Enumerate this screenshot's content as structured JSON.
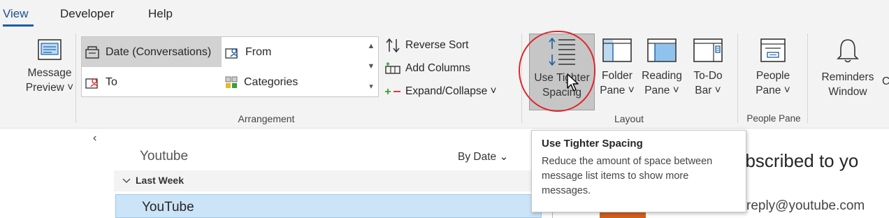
{
  "tabs": [
    "View",
    "Developer",
    "Help"
  ],
  "ribbon": {
    "message_preview": [
      "Message",
      "Preview ˅"
    ],
    "arrangement": {
      "items": [
        "Date (Conversations)",
        "From",
        "To",
        "Categories"
      ],
      "label": "Arrangement"
    },
    "reverse_sort": "Reverse Sort",
    "add_columns": "Add Columns",
    "expand_collapse": "Expand/Collapse ˅",
    "use_tighter_spacing": [
      "Use Tighter",
      "Spacing"
    ],
    "folder_pane": [
      "Folder",
      "Pane ˅"
    ],
    "reading_pane": [
      "Reading",
      "Pane ˅"
    ],
    "todo_bar": [
      "To-Do",
      "Bar ˅"
    ],
    "layout_label": "Layout",
    "people_pane": [
      "People",
      "Pane ˅"
    ],
    "people_pane_label": "People Pane",
    "reminders_window": [
      "Reminders",
      "Window"
    ],
    "cutoff_letter": "C"
  },
  "mail_list": {
    "collapse_glyph": "‹",
    "folder": "Youtube",
    "sort": "By Date ⌄",
    "group": "Last Week",
    "sender": "YouTube"
  },
  "reading": {
    "title": "ubscribed to yo",
    "address": "reply@youtube.com"
  },
  "tooltip": {
    "title": "Use Tighter Spacing",
    "body": "Reduce the amount of space between message list items to show more messages."
  },
  "colors": {
    "accent": "#1b5ea6",
    "annotation": "#e0262b",
    "selection": "#cce4f7"
  }
}
